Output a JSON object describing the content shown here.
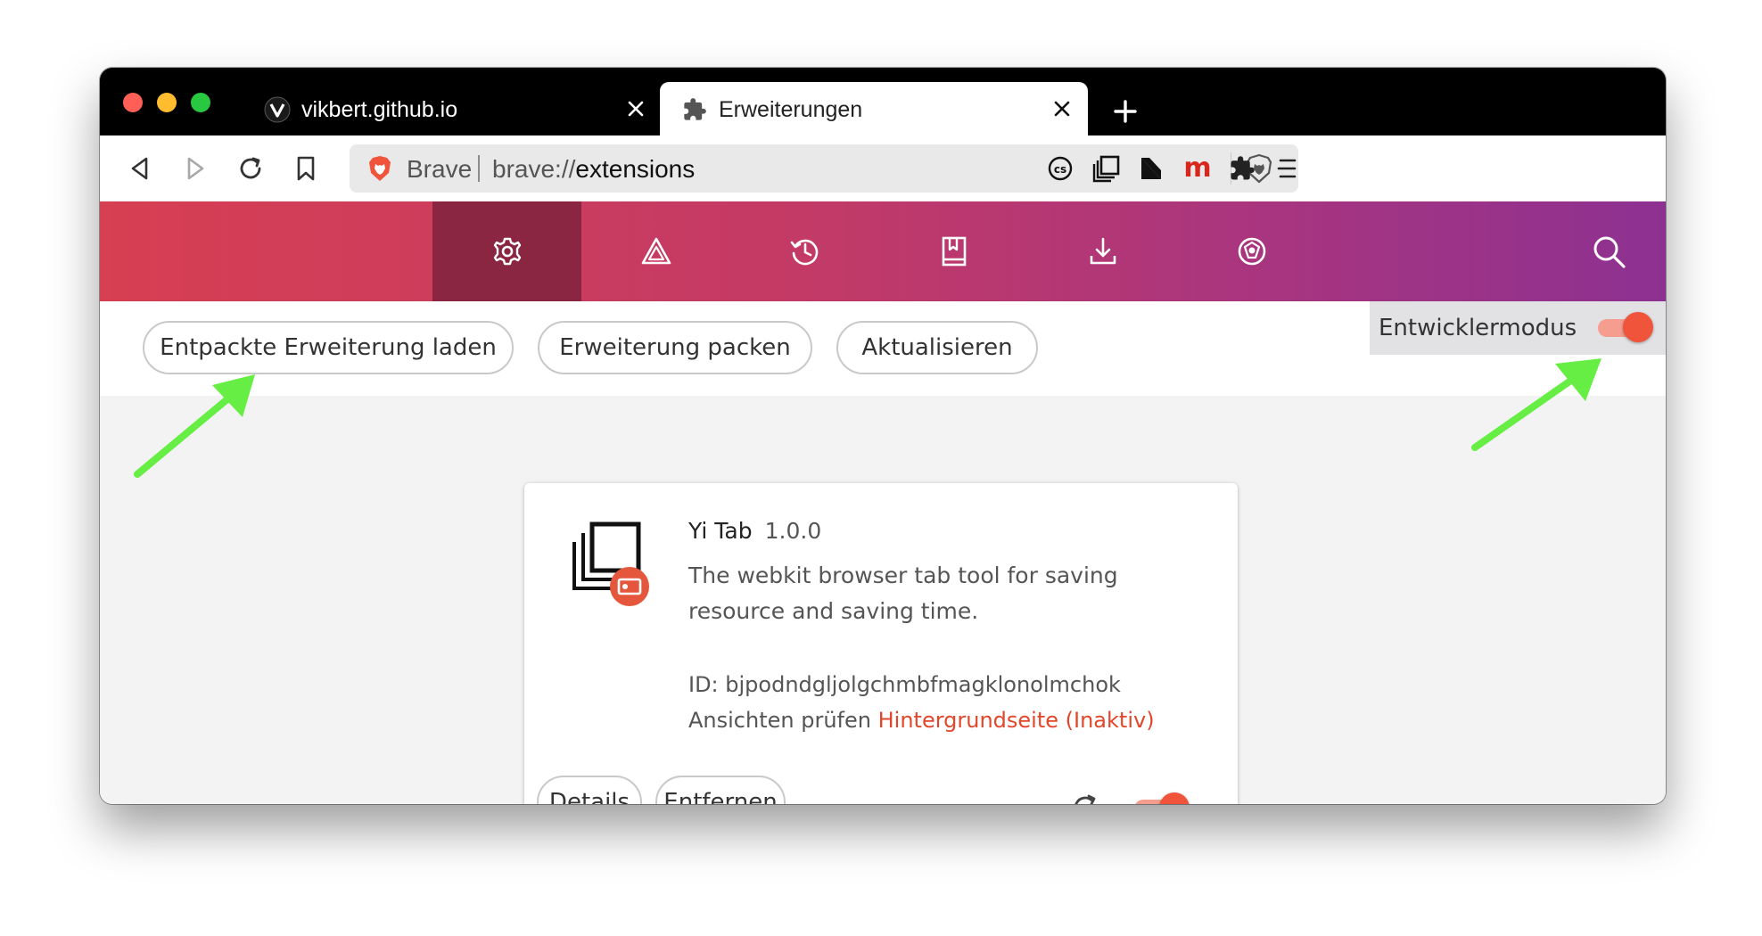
{
  "tabs": [
    {
      "title": "vikbert.github.io",
      "active": false
    },
    {
      "title": "Erweiterungen",
      "active": true
    }
  ],
  "address_bar": {
    "shield_label": "Brave",
    "scheme": "brave://",
    "host": "extensions"
  },
  "nav": {
    "items": [
      "settings-icon",
      "rewards-icon",
      "history-icon",
      "bookmarks-icon",
      "downloads-icon",
      "wallet-icon"
    ],
    "active": "settings-icon"
  },
  "dev_toolbar": {
    "load_unpacked": "Entpackte Erweiterung laden",
    "pack": "Erweiterung packen",
    "update": "Aktualisieren",
    "dev_mode_label": "Entwicklermodus",
    "dev_mode_on": true
  },
  "extension": {
    "name": "Yi Tab",
    "version": "1.0.0",
    "description": "The webkit browser tab tool for saving resource and saving time.",
    "id_line": "ID: bjpodndgljolgchmbfmagklonolmchok",
    "views_label": "Ansichten prüfen",
    "views_link": "Hintergrundseite (Inaktiv)",
    "details_label": "Details",
    "remove_label": "Entfernen",
    "enabled": true
  },
  "colors": {
    "accent": "#f0543b",
    "link": "#e2472b",
    "arrow": "#66ee44",
    "nav_active": "#8a2542"
  }
}
